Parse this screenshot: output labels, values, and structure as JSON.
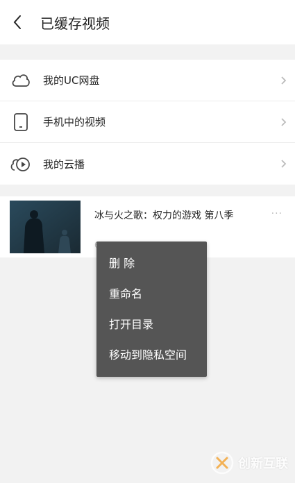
{
  "header": {
    "title": "已缓存视频",
    "back_icon": "chevron-left-icon"
  },
  "menu": {
    "items": [
      {
        "label": "我的UC网盘",
        "icon": "cloud-icon"
      },
      {
        "label": "手机中的视频",
        "icon": "phone-icon"
      },
      {
        "label": "我的云播",
        "icon": "cloud-play-icon"
      }
    ]
  },
  "video": {
    "title": "冰与火之歌：权力的游戏 第八季",
    "subtitle": "6",
    "more": "···"
  },
  "context_menu": {
    "items": [
      "删 除",
      "重命名",
      "打开目录",
      "移动到隐私空间"
    ]
  },
  "watermark": {
    "text": "创新互联"
  },
  "colors": {
    "menu_bg": "#555555",
    "page_bg": "#f2f2f2",
    "chevron": "#bbbbbb"
  }
}
